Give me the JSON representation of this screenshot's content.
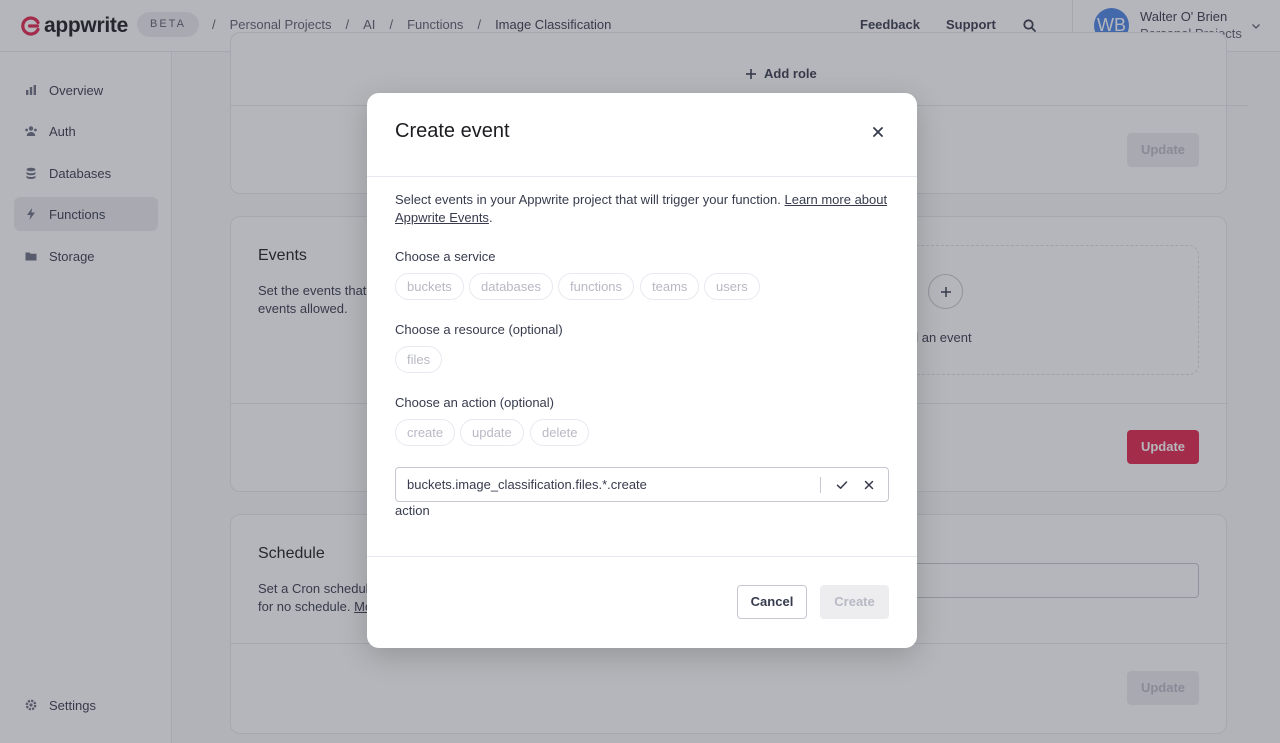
{
  "header": {
    "brand": "appwrite",
    "badge": "BETA",
    "breadcrumbs": [
      {
        "label": "Personal Projects"
      },
      {
        "label": "AI"
      },
      {
        "label": "Functions"
      },
      {
        "label": "Image Classification"
      }
    ],
    "separator": "/",
    "feedback_label": "Feedback",
    "support_label": "Support",
    "user": {
      "initials": "WB",
      "name": "Walter O' Brien",
      "org": "Personal Projects"
    }
  },
  "sidebar": {
    "items": [
      {
        "label": "Overview",
        "icon": "chart-icon"
      },
      {
        "label": "Auth",
        "icon": "users-icon"
      },
      {
        "label": "Databases",
        "icon": "database-icon"
      },
      {
        "label": "Functions",
        "icon": "lightning-icon",
        "active": true
      },
      {
        "label": "Storage",
        "icon": "folder-icon"
      }
    ],
    "settings_label": "Settings"
  },
  "permissions_card": {
    "add_role_label": "Add role",
    "update_label": "Update"
  },
  "events_card": {
    "title": "Events",
    "description_line1": "Set the events that",
    "description_line2": "events allowed.",
    "add_event_label": "ld an event",
    "update_label": "Update"
  },
  "schedule_card": {
    "title": "Schedule",
    "description_line1": "Set a Cron schedule",
    "description_line2_prefix": "for no schedule.",
    "description_line2_link": "Mo",
    "update_label": "Update"
  },
  "modal": {
    "title": "Create event",
    "intro_text": "Select events in your Appwrite project that will trigger your function.",
    "intro_link_line1": "Learn more about",
    "intro_link_line2": "Appwrite Events",
    "intro_period": ".",
    "service_label": "Choose a service",
    "services": [
      "buckets",
      "databases",
      "functions",
      "teams",
      "users"
    ],
    "resource_label": "Choose a resource (optional)",
    "resources": [
      "files"
    ],
    "action_label": "Choose an action (optional)",
    "actions": [
      "create",
      "update",
      "delete"
    ],
    "event_value": "buckets.image_classification.files.*.create",
    "field_hint": "action",
    "cancel_label": "Cancel",
    "create_label": "Create"
  },
  "colors": {
    "brand": "#e3254d",
    "avatar": "#4b86e6",
    "overlay": "rgba(55,56,70,0.37)"
  }
}
